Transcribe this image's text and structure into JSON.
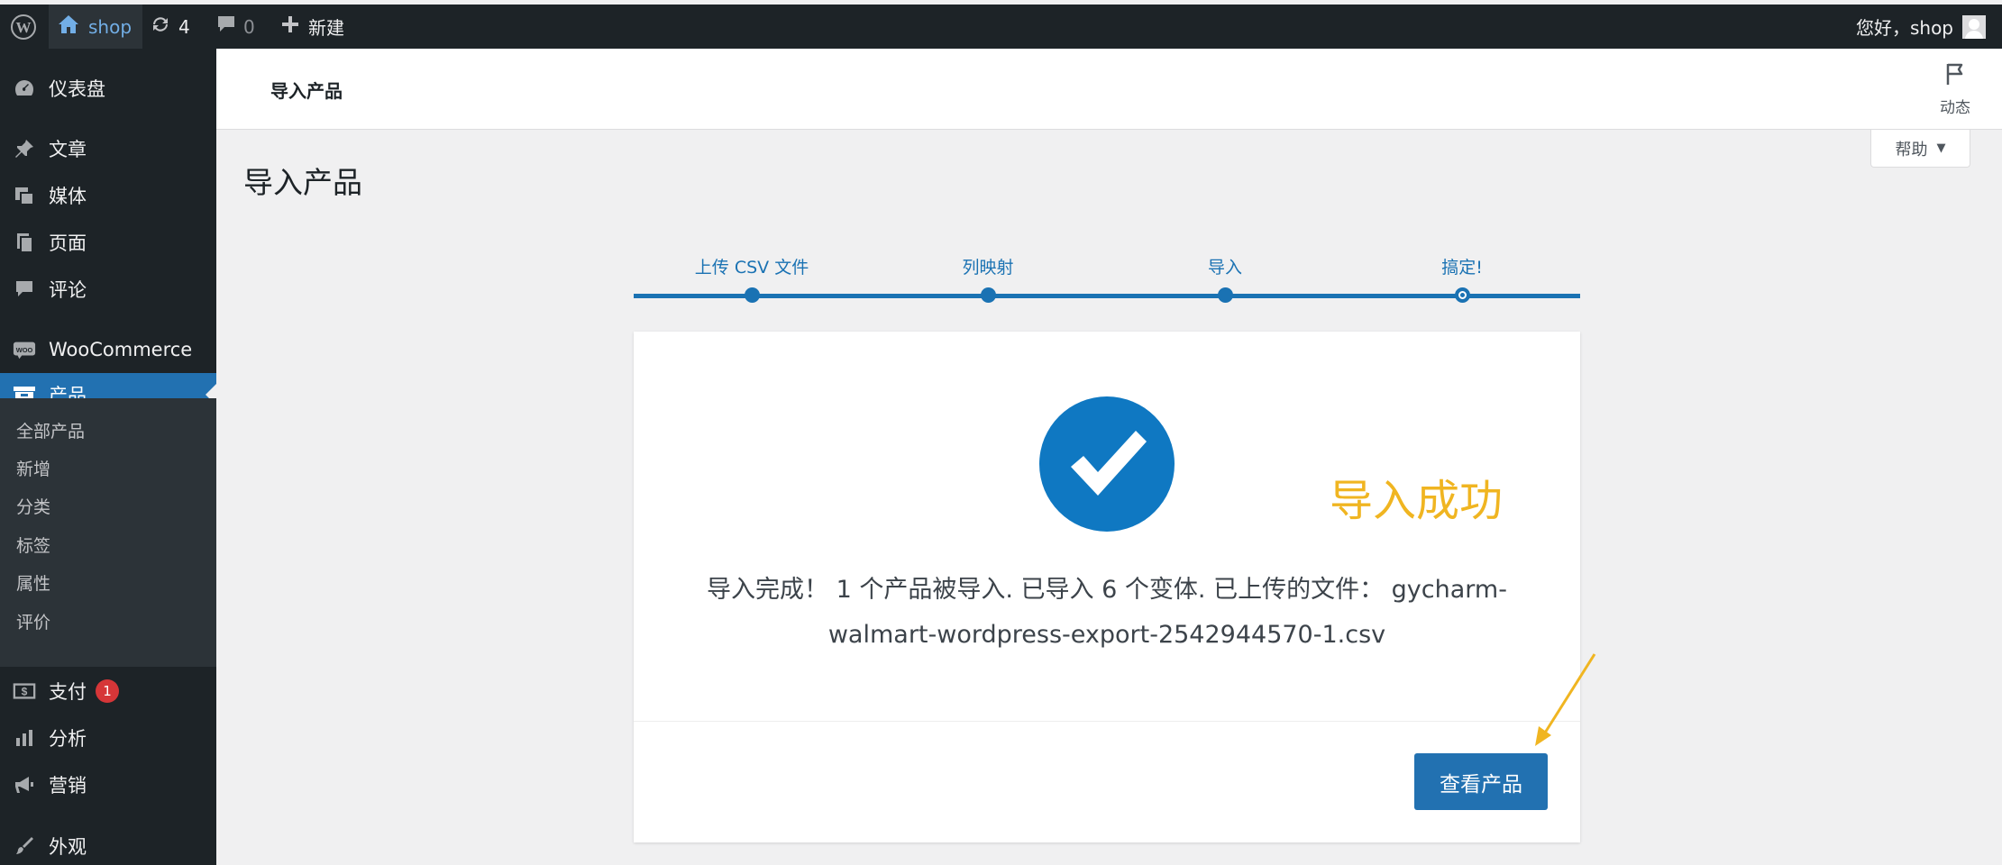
{
  "admin_bar": {
    "site_name": "shop",
    "updates_count": "4",
    "comments_count": "0",
    "new_label": "新建",
    "greeting": "您好，shop"
  },
  "sidebar": {
    "items": [
      {
        "label": "仪表盘",
        "icon": "dashboard-icon"
      },
      {
        "label": "文章",
        "icon": "pin-icon"
      },
      {
        "label": "媒体",
        "icon": "media-icon"
      },
      {
        "label": "页面",
        "icon": "page-icon"
      },
      {
        "label": "评论",
        "icon": "comment-icon"
      },
      {
        "label": "WooCommerce",
        "icon": "woo-icon"
      },
      {
        "label": "产品",
        "icon": "archive-icon"
      },
      {
        "label": "支付",
        "icon": "payment-icon",
        "badge": "1"
      },
      {
        "label": "分析",
        "icon": "bar-chart-icon"
      },
      {
        "label": "营销",
        "icon": "megaphone-icon"
      },
      {
        "label": "外观",
        "icon": "brush-icon"
      }
    ],
    "submenu": [
      "全部产品",
      "新增",
      "分类",
      "标签",
      "属性",
      "评价"
    ]
  },
  "header": {
    "title": "导入产品",
    "activity_label": "动态",
    "help_label": "帮助"
  },
  "page_title": "导入产品",
  "steps": [
    "上传 CSV 文件",
    "列映射",
    "导入",
    "搞定!"
  ],
  "card": {
    "success_label": "导入成功",
    "done_text": "导入完成！ 1 个产品被导入. 已导入 6 个变体. 已上传的文件： gycharm-walmart-wordpress-export-2542944570-1.csv",
    "button_label": "查看产品"
  },
  "colors": {
    "admin_bg": "#1d2327",
    "accent": "#2271b1",
    "step_blue": "#1a72b3",
    "success_yellow": "#f0b521",
    "badge_red": "#d63638"
  }
}
